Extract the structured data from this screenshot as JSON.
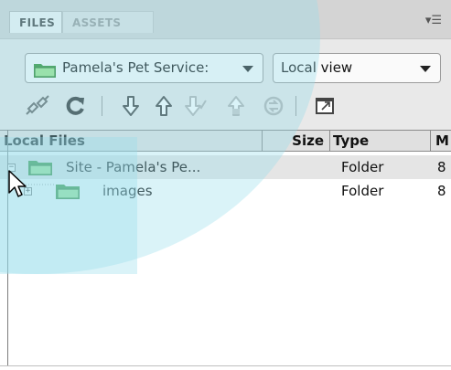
{
  "tabs": [
    {
      "label": "FILES",
      "active": true
    },
    {
      "label": "ASSETS",
      "active": false
    }
  ],
  "panel_menu_icon": "panel-menu-icon",
  "site_select": {
    "value": "Pamela's Pet Service:",
    "icon": "folder-icon"
  },
  "view_select": {
    "value": "Local view"
  },
  "toolbar_icons": [
    "connect-icon",
    "refresh-icon",
    "get-files-icon",
    "put-files-icon",
    "check-out-icon",
    "check-in-icon",
    "synchronize-icon",
    "expand-view-icon"
  ],
  "table": {
    "columns": [
      "Local Files",
      "Size",
      "Type",
      "M"
    ],
    "rows": [
      {
        "name": "Site - Pamela's Pe...",
        "size": "",
        "type": "Folder",
        "modified": "8",
        "level": 0,
        "expanded": true
      },
      {
        "name": "images",
        "size": "",
        "type": "Folder",
        "modified": "8",
        "level": 1,
        "expanded": false
      }
    ]
  },
  "colors": {
    "folder_green": "#3aa53a",
    "overlay_cyan": "#96dceb",
    "header_bg": "#e0e0e0"
  }
}
